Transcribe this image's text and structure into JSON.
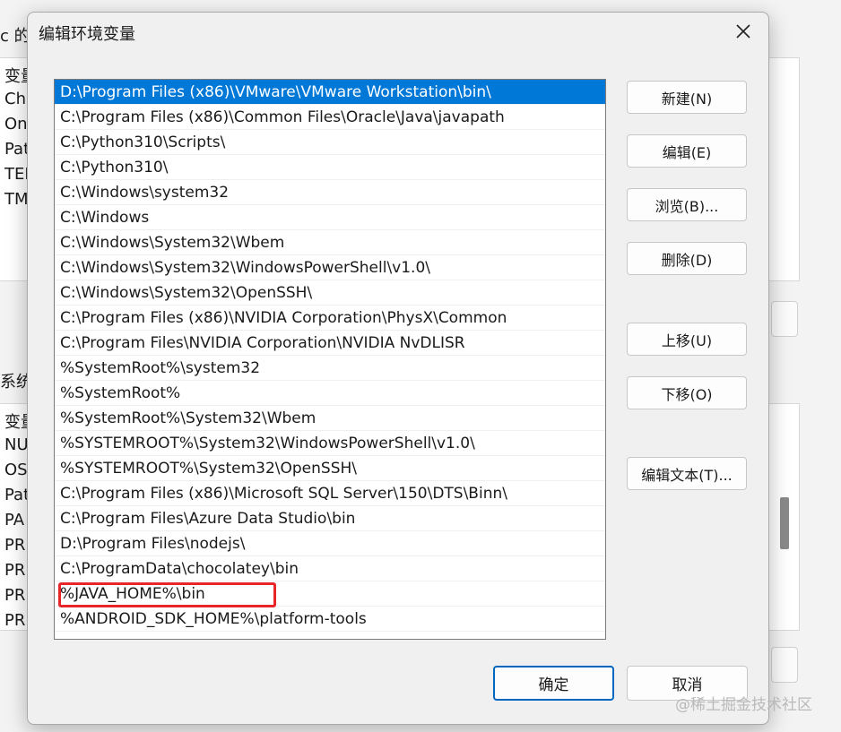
{
  "background": {
    "title_fragment": "c 的",
    "user_vars": {
      "header": "变量",
      "items": [
        "Ch",
        "On",
        "Pat",
        "TEI",
        "TM"
      ]
    },
    "section_label": "系统变",
    "system_vars": {
      "header": "变量",
      "items": [
        "NU",
        "OS",
        "Pat",
        "PA",
        "PR",
        "PR",
        "PR",
        "PR"
      ]
    }
  },
  "dialog": {
    "title": "编辑环境变量",
    "close_icon": "close-icon",
    "entries": [
      "D:\\Program Files (x86)\\VMware\\VMware Workstation\\bin\\",
      "C:\\Program Files (x86)\\Common Files\\Oracle\\Java\\javapath",
      "C:\\Python310\\Scripts\\",
      "C:\\Python310\\",
      "C:\\Windows\\system32",
      "C:\\Windows",
      "C:\\Windows\\System32\\Wbem",
      "C:\\Windows\\System32\\WindowsPowerShell\\v1.0\\",
      "C:\\Windows\\System32\\OpenSSH\\",
      "C:\\Program Files (x86)\\NVIDIA Corporation\\PhysX\\Common",
      "C:\\Program Files\\NVIDIA Corporation\\NVIDIA NvDLISR",
      "%SystemRoot%\\system32",
      "%SystemRoot%",
      "%SystemRoot%\\System32\\Wbem",
      "%SYSTEMROOT%\\System32\\WindowsPowerShell\\v1.0\\",
      "%SYSTEMROOT%\\System32\\OpenSSH\\",
      "C:\\Program Files (x86)\\Microsoft SQL Server\\150\\DTS\\Binn\\",
      "C:\\Program Files\\Azure Data Studio\\bin",
      "D:\\Program Files\\nodejs\\",
      "C:\\ProgramData\\chocolatey\\bin",
      "%JAVA_HOME%\\bin",
      "%ANDROID_SDK_HOME%\\platform-tools"
    ],
    "selected_index": 0,
    "highlighted_index": 20,
    "buttons": {
      "new": "新建(N)",
      "edit": "编辑(E)",
      "browse": "浏览(B)...",
      "delete": "删除(D)",
      "move_up": "上移(U)",
      "move_down": "下移(O)",
      "edit_text": "编辑文本(T)...",
      "ok": "确定",
      "cancel": "取消"
    },
    "accent_color": "#0078d7",
    "highlight_color": "#e8262a"
  },
  "watermark": "@稀土掘金技术社区"
}
